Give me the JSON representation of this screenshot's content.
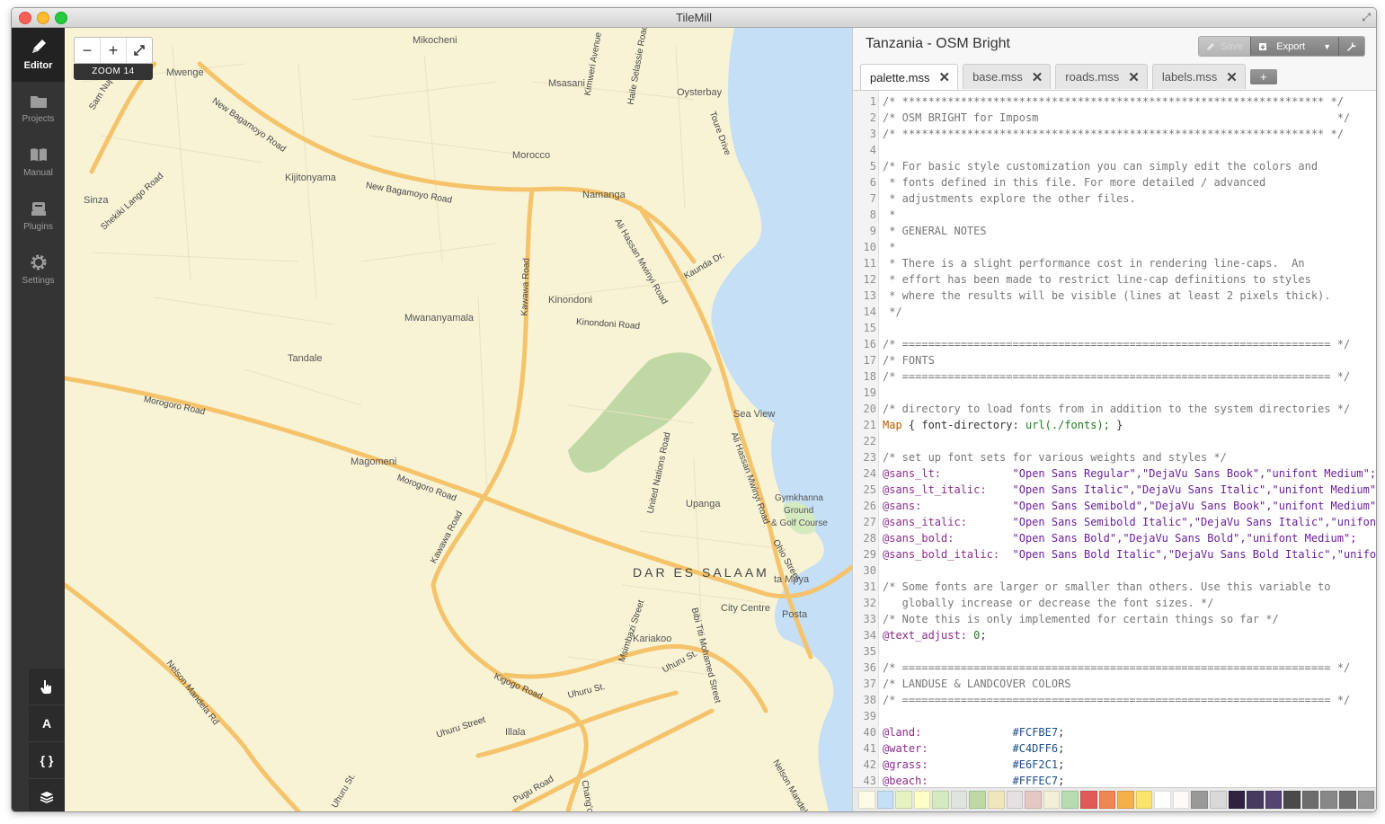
{
  "window": {
    "title": "TileMill"
  },
  "sidebar": {
    "items": [
      {
        "label": "Editor",
        "icon": "pencil-icon"
      },
      {
        "label": "Projects",
        "icon": "folder-icon"
      },
      {
        "label": "Manual",
        "icon": "book-icon"
      },
      {
        "label": "Plugins",
        "icon": "plugin-icon"
      },
      {
        "label": "Settings",
        "icon": "gear-icon"
      }
    ]
  },
  "map_tools": [
    {
      "label": "",
      "icon": "hand-pointer-icon"
    },
    {
      "label": "A",
      "icon": "font-icon"
    },
    {
      "label": "{ }",
      "icon": "braces-icon"
    },
    {
      "label": "",
      "icon": "layers-icon"
    }
  ],
  "zoom": {
    "minus": "−",
    "plus": "+",
    "label": "ZOOM 14"
  },
  "map": {
    "labels": [
      "Mikocheni",
      "Mwenge",
      "Msasani",
      "Oysterbay",
      "Sam Nujoma Rd",
      "New Bagamoyo Road",
      "Haile Selassie Road",
      "Kimweri Avenue",
      "Toure Drive",
      "Morocco",
      "Kijitonyama",
      "New Bagamoyo Road",
      "Namanga",
      "Sinza",
      "Shekiki Lango Road",
      "Ali Hassan Mwinyi Road",
      "Kaunda Dr.",
      "Kawawa Road",
      "Kinondoni",
      "Kinondoni Road",
      "Mwananyamala",
      "Tandale",
      "Morogoro Road",
      "Sea View",
      "Magomeni",
      "Morogoro Road",
      "United Nations Road",
      "Ali Hassan Mwinyi Road",
      "Gymkhanna",
      "Ground",
      "& Golf Course",
      "Upanga",
      "Kawawa Road",
      "Ohio Street",
      "DAR ES SALAAM",
      "ta Mpya",
      "City Centre",
      "Posta",
      "Msimbazi Street",
      "Bibi Titi Mohamed Street",
      "Kariakoo",
      "Uhuru St.",
      "Nelson Mandela Rd",
      "Kigogo Road",
      "Uhuru St.",
      "Uhuru Street",
      "Illala",
      "Pugu Road",
      "Chang'ombe",
      "Uhuru St.",
      "Nelson Mandela"
    ]
  },
  "editor": {
    "project_title": "Tanzania - OSM Bright",
    "save_label": "Save",
    "export_label": "Export",
    "tabs": [
      {
        "label": "palette.mss",
        "active": true
      },
      {
        "label": "base.mss",
        "active": false
      },
      {
        "label": "roads.mss",
        "active": false
      },
      {
        "label": "labels.mss",
        "active": false
      }
    ],
    "add_tab_label": "+",
    "lines": [
      {
        "n": "1",
        "t": "/* ***************************************************************** */",
        "k": "c"
      },
      {
        "n": "2",
        "t": "/* OSM BRIGHT for Imposm                                              */",
        "k": "c"
      },
      {
        "n": "3",
        "t": "/* ***************************************************************** */",
        "k": "c"
      },
      {
        "n": "4",
        "t": "",
        "k": "c"
      },
      {
        "n": "5",
        "t": "/* For basic style customization you can simply edit the colors and",
        "k": "c"
      },
      {
        "n": "6",
        "t": " * fonts defined in this file. For more detailed / advanced",
        "k": "c"
      },
      {
        "n": "7",
        "t": " * adjustments explore the other files.",
        "k": "c"
      },
      {
        "n": "8",
        "t": " *",
        "k": "c"
      },
      {
        "n": "9",
        "t": " * GENERAL NOTES",
        "k": "c"
      },
      {
        "n": "10",
        "t": " *",
        "k": "c"
      },
      {
        "n": "11",
        "t": " * There is a slight performance cost in rendering line-caps.  An",
        "k": "c"
      },
      {
        "n": "12",
        "t": " * effort has been made to restrict line-cap definitions to styles",
        "k": "c"
      },
      {
        "n": "13",
        "t": " * where the results will be visible (lines at least 2 pixels thick).",
        "k": "c"
      },
      {
        "n": "14",
        "t": " */",
        "k": "c"
      },
      {
        "n": "15",
        "t": "",
        "k": "c"
      },
      {
        "n": "16",
        "t": "/* ================================================================== */",
        "k": "c"
      },
      {
        "n": "17",
        "t": "/* FONTS",
        "k": "c"
      },
      {
        "n": "18",
        "t": "/* ================================================================== */",
        "k": "c"
      },
      {
        "n": "19",
        "t": "",
        "k": "c"
      },
      {
        "n": "20",
        "t": "/* directory to load fonts from in addition to the system directories */",
        "k": "c"
      },
      {
        "n": "21",
        "k": "map",
        "a": "Map",
        "b": " { font-directory: ",
        "c": "url(./fonts);",
        "d": " }"
      },
      {
        "n": "22",
        "t": "",
        "k": "c"
      },
      {
        "n": "23",
        "t": "/* set up font sets for various weights and styles */",
        "k": "c"
      },
      {
        "n": "24",
        "k": "var",
        "a": "@sans_lt:",
        "pad": "           ",
        "b": "\"Open Sans Regular\",\"DejaVu Sans Book\",\"unifont Medium\";"
      },
      {
        "n": "25",
        "k": "var",
        "a": "@sans_lt_italic:",
        "pad": "    ",
        "b": "\"Open Sans Italic\",\"DejaVu Sans Italic\",\"unifont Medium\";"
      },
      {
        "n": "26",
        "k": "var",
        "a": "@sans:",
        "pad": "              ",
        "b": "\"Open Sans Semibold\",\"DejaVu Sans Book\",\"unifont Medium\";"
      },
      {
        "n": "27",
        "k": "var",
        "a": "@sans_italic:",
        "pad": "       ",
        "b": "\"Open Sans Semibold Italic\",\"DejaVu Sans Italic\",\"unifont M"
      },
      {
        "n": "28",
        "k": "var",
        "a": "@sans_bold:",
        "pad": "         ",
        "b": "\"Open Sans Bold\",\"DejaVu Sans Bold\",\"unifont Medium\";"
      },
      {
        "n": "29",
        "k": "var",
        "a": "@sans_bold_italic:",
        "pad": "  ",
        "b": "\"Open Sans Bold Italic\",\"DejaVu Sans Bold Italic\",\"unifont"
      },
      {
        "n": "30",
        "t": "",
        "k": "c"
      },
      {
        "n": "31",
        "t": "/* Some fonts are larger or smaller than others. Use this variable to",
        "k": "c"
      },
      {
        "n": "32",
        "t": "   globally increase or decrease the font sizes. */",
        "k": "c"
      },
      {
        "n": "33",
        "t": "/* Note this is only implemented for certain things so far */",
        "k": "c"
      },
      {
        "n": "34",
        "k": "num",
        "a": "@text_adjust:",
        "b": " ",
        "c": "0",
        "d": ";"
      },
      {
        "n": "35",
        "t": "",
        "k": "c"
      },
      {
        "n": "36",
        "t": "/* ================================================================== */",
        "k": "c"
      },
      {
        "n": "37",
        "t": "/* LANDUSE & LANDCOVER COLORS",
        "k": "c"
      },
      {
        "n": "38",
        "t": "/* ================================================================== */",
        "k": "c"
      },
      {
        "n": "39",
        "t": "",
        "k": "c"
      },
      {
        "n": "40",
        "k": "hex",
        "a": "@land:",
        "pad": "              ",
        "b": "#FCFBE7",
        "d": ";"
      },
      {
        "n": "41",
        "k": "hex",
        "a": "@water:",
        "pad": "             ",
        "b": "#C4DFF6",
        "d": ";"
      },
      {
        "n": "42",
        "k": "hex",
        "a": "@grass:",
        "pad": "             ",
        "b": "#E6F2C1",
        "d": ";"
      },
      {
        "n": "43",
        "k": "hex",
        "a": "@beach:",
        "pad": "             ",
        "b": "#FFFEC7",
        "d": ";"
      }
    ]
  },
  "palette_colors": [
    "#fcfbe7",
    "#c4dff6",
    "#e6f2c1",
    "#fffec7",
    "#d6eac0",
    "#dfe4dd",
    "#c0d8a6",
    "#efe7bc",
    "#e5e0e2",
    "#e4c8c4",
    "#f3f0d8",
    "#b6dcb0",
    "#e05a58",
    "#ee8751",
    "#f4b14a",
    "#fbe46c",
    "#ffffff",
    "#fcfbf8",
    "#999999",
    "#d9d9d9",
    "#2e2442",
    "#463a5e",
    "#534472",
    "#4a4a4a",
    "#6d6d6d",
    "#888888",
    "#707070",
    "#969696"
  ]
}
